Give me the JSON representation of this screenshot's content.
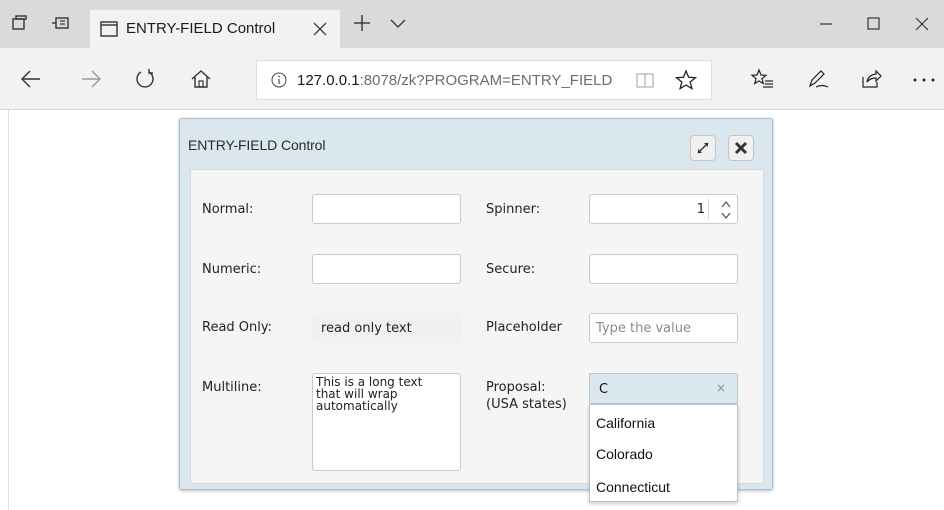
{
  "browser": {
    "tab_title": "ENTRY-FIELD Control",
    "url_host": "127.0.0.1",
    "url_rest": ":8078/zk?PROGRAM=ENTRY_FIELD",
    "icons": [
      "set-tabs-aside-icon",
      "show-tabs-icon",
      "page-icon",
      "close-tab-icon",
      "new-tab-icon",
      "tab-list-chevron-icon",
      "minimize-icon",
      "maximize-icon",
      "close-window-icon",
      "back-icon",
      "forward-icon",
      "refresh-icon",
      "home-icon",
      "info-icon",
      "reading-view-icon",
      "favorite-star-icon",
      "favorites-hub-icon",
      "web-note-icon",
      "share-icon",
      "more-icon"
    ]
  },
  "dialog": {
    "title": "ENTRY-FIELD Control",
    "background": "#dbe7ef",
    "fields": {
      "normal": {
        "label": "Normal:",
        "value": ""
      },
      "numeric": {
        "label": "Numeric:",
        "value": ""
      },
      "read_only": {
        "label": "Read Only:",
        "value": "read only text"
      },
      "multiline": {
        "label": "Multiline:",
        "value": "This is a long text\nthat will wrap\nautomatically"
      },
      "spinner": {
        "label": "Spinner:",
        "value": "1"
      },
      "secure": {
        "label": "Secure:",
        "value": ""
      },
      "placeholder": {
        "label": "Placeholder",
        "placeholder": "Type the value"
      },
      "proposal": {
        "label_line1": "Proposal:",
        "label_line2": "(USA states)",
        "value": "C",
        "clear": "×"
      }
    },
    "dropdown_options": [
      "California",
      "Colorado",
      "Connecticut"
    ]
  }
}
